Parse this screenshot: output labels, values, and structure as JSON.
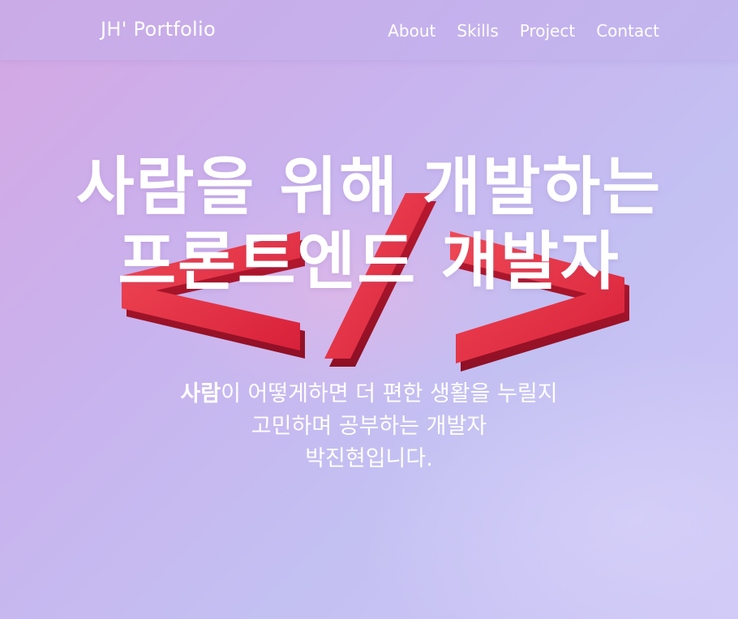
{
  "header": {
    "logo": "JH' Portfolio",
    "nav": [
      "About",
      "Skills",
      "Project",
      "Contact"
    ]
  },
  "hero": {
    "title_line1": "사람을 위해 개발하는",
    "title_line2": "프론트엔드 개발자",
    "desc_highlight": "사람",
    "desc_line1_rest": "이 어떻게하면 더 편한 생활을 누릴지",
    "desc_line2": "고민하며 공부하는 개발자",
    "desc_line3": "박진현입니다."
  },
  "colors": {
    "accent_code_symbol": "#e8323f",
    "background_from": "#d4a7e3",
    "background_to": "#cfc7f6"
  },
  "icons": {
    "background_graphic": "code-brackets-icon"
  }
}
